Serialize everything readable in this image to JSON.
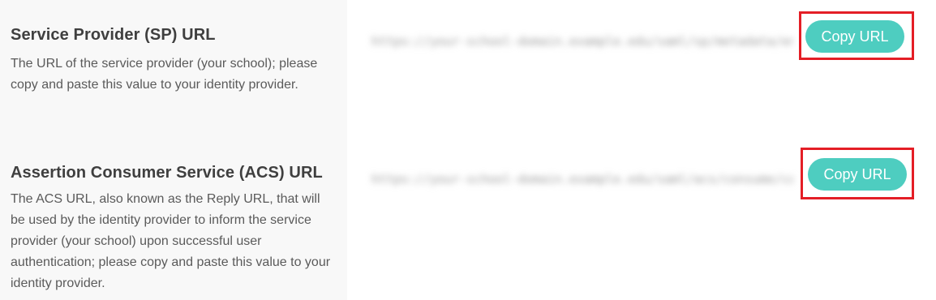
{
  "sp_section": {
    "title": "Service Provider (SP) URL",
    "description": "The URL of the service provider (your school); please copy and paste this value to your identity provider.",
    "url_value": "https://your-school-domain.example.edu/saml/sp/metadata/entity-id",
    "copy_label": "Copy URL"
  },
  "acs_section": {
    "title": "Assertion Consumer Service (ACS) URL",
    "description": "The ACS URL, also known as the Reply URL, that will be used by the identity provider to inform the service provider (your school) upon successful user authentication; please copy and paste this value to your identity provider.",
    "url_value": "https://your-school-domain.example.edu/saml/acs/consume/callback",
    "copy_label": "Copy URL"
  },
  "colors": {
    "button_bg": "#4ecdc0",
    "highlight": "#e41e26",
    "panel_bg": "#f8f8f8"
  }
}
